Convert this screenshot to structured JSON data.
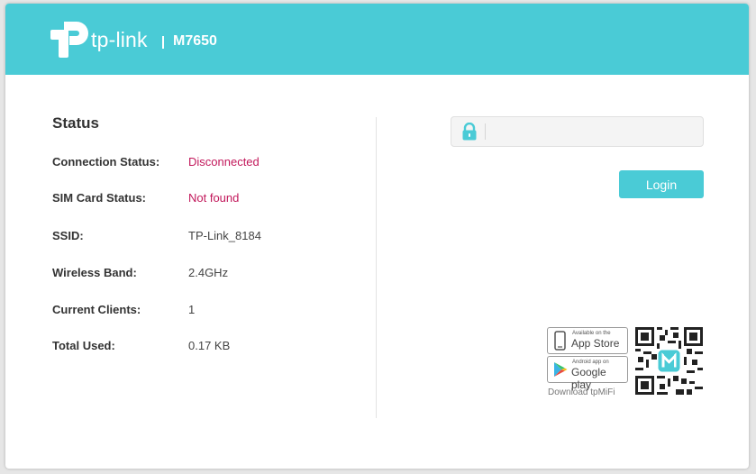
{
  "header": {
    "brand": "tp-link",
    "model": "M7650",
    "color": "#4acbd6"
  },
  "status": {
    "title": "Status",
    "rows": [
      {
        "label": "Connection Status:",
        "value": "Disconnected",
        "alert": true
      },
      {
        "label": "SIM Card Status:",
        "value": "Not found",
        "alert": true
      },
      {
        "label": "SSID:",
        "value": "TP-Link_8184",
        "alert": false
      },
      {
        "label": "Wireless Band:",
        "value": "2.4GHz",
        "alert": false
      },
      {
        "label": "Current Clients:",
        "value": "1",
        "alert": false
      },
      {
        "label": "Total Used:",
        "value": "0.17 KB",
        "alert": false
      }
    ],
    "alert_color": "#c2185b"
  },
  "login": {
    "password_value": "",
    "lock_icon": "lock-icon",
    "button_label": "Login"
  },
  "app_download": {
    "app_store": {
      "small": "Available on the",
      "big": "App Store",
      "icon": "phone-icon"
    },
    "google_play": {
      "small": "Android app on",
      "big": "Google play",
      "icon": "play-icon"
    },
    "label": "Download tpMiFi",
    "qr_icon": "qr-code-icon"
  }
}
